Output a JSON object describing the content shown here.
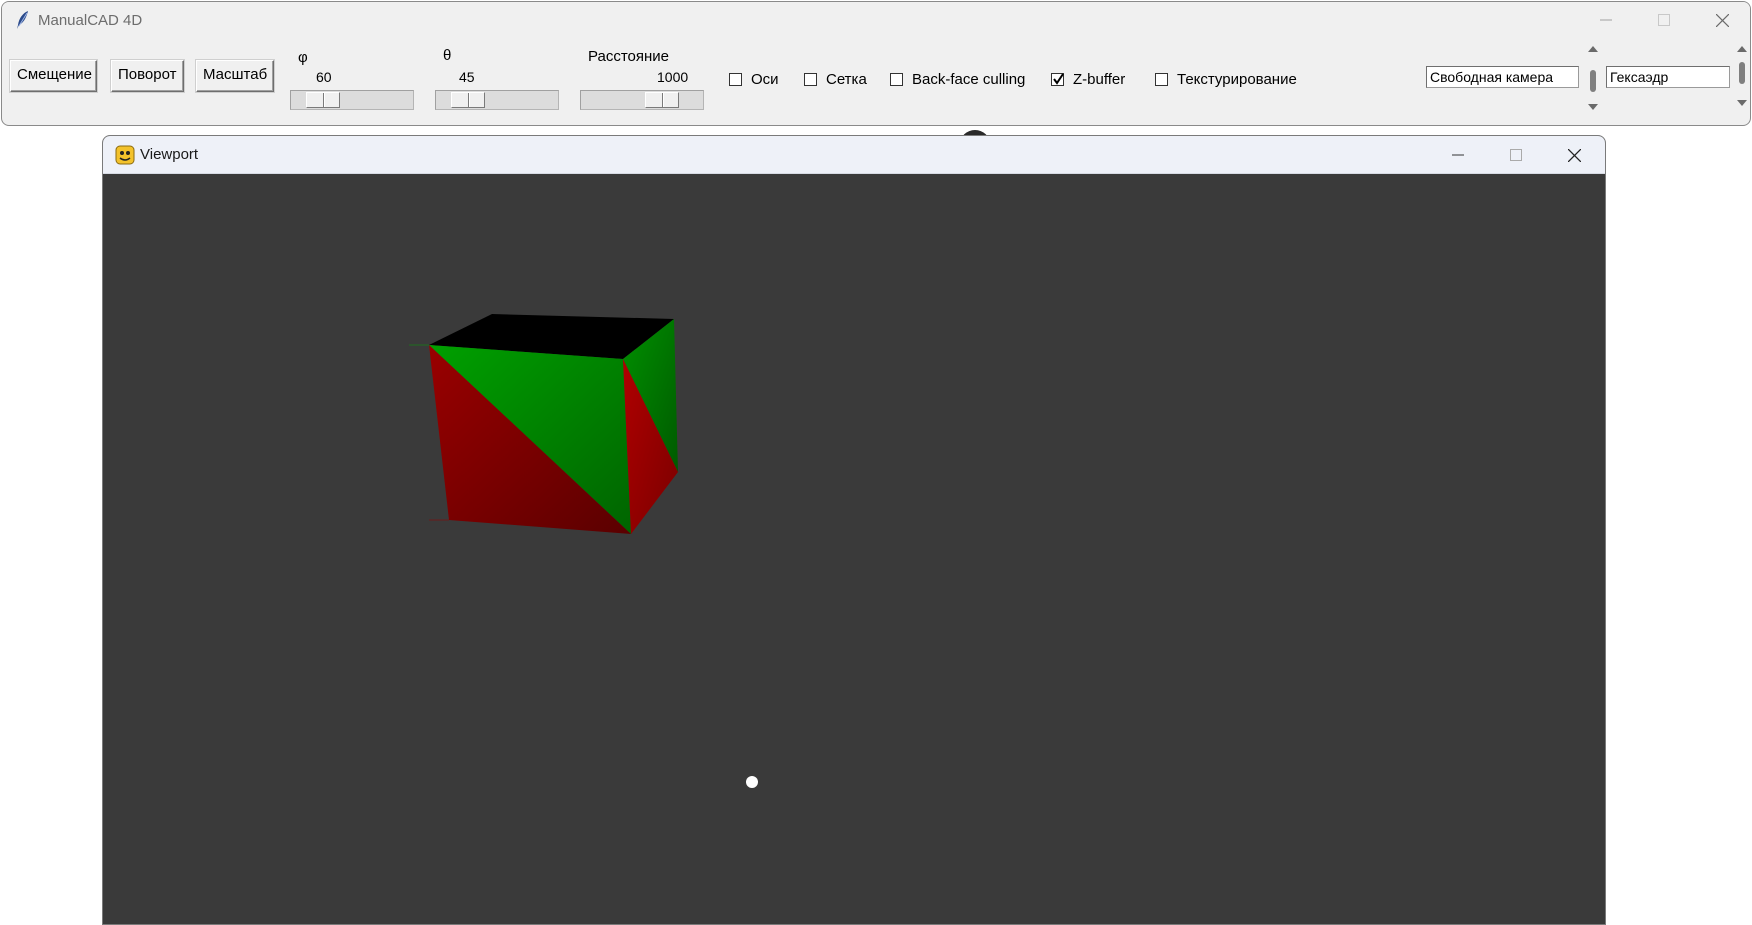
{
  "main_window": {
    "title": "ManualCAD 4D",
    "buttons": {
      "translate": "Смещение",
      "rotate": "Поворот",
      "scale": "Масштаб"
    },
    "sliders": {
      "phi": {
        "label": "φ",
        "value": "60",
        "fraction": 0.17
      },
      "theta": {
        "label": "θ",
        "value": "45",
        "fraction": 0.17
      },
      "distance": {
        "label": "Расстояние",
        "value": "1000",
        "fraction": 0.73
      }
    },
    "checkboxes": {
      "axes": {
        "label": "Оси",
        "checked": false
      },
      "grid": {
        "label": "Сетка",
        "checked": false
      },
      "backface": {
        "label": "Back-face culling",
        "checked": false
      },
      "zbuffer": {
        "label": "Z-buffer",
        "checked": true
      },
      "texturing": {
        "label": "Текстурирование",
        "checked": false
      }
    },
    "camera_select": {
      "value": "Свободная камера"
    },
    "shape_select": {
      "value": "Гексаэдр"
    }
  },
  "viewport_window": {
    "title": "Viewport",
    "background_color": "#3a3a3a",
    "shape": {
      "name": "cube",
      "face_colors": {
        "top": "#000000",
        "green": "#008000",
        "red": "#800000"
      }
    }
  },
  "colors": {
    "window_bg": "#f0f0f0",
    "titlebar_text": "#6d6d6d"
  }
}
